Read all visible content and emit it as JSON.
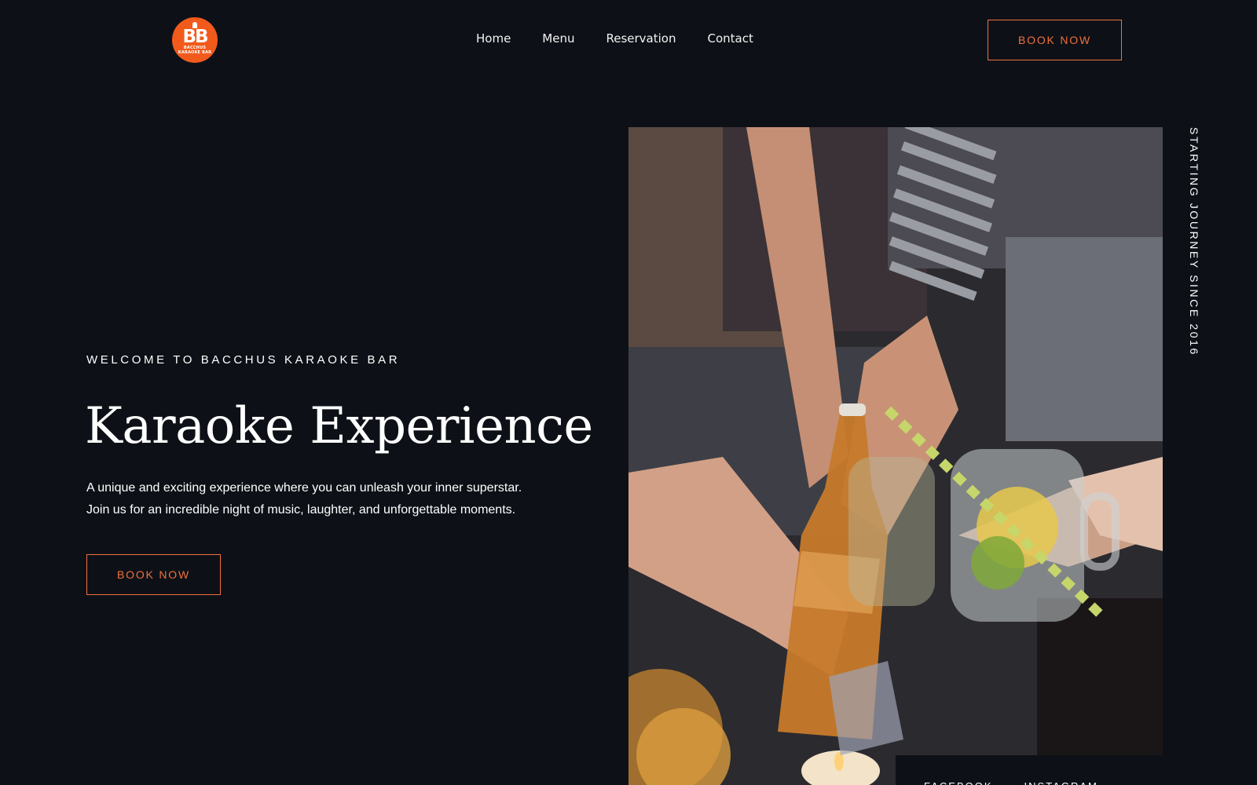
{
  "brand": {
    "logo_text": "BB",
    "logo_line1": "BACCHUS",
    "logo_line2": "KARAOKE BAR",
    "accent_color": "#f25a1c"
  },
  "nav": {
    "items": [
      {
        "label": "Home"
      },
      {
        "label": "Menu"
      },
      {
        "label": "Reservation"
      },
      {
        "label": "Contact"
      }
    ]
  },
  "header": {
    "cta_label": "BOOK NOW"
  },
  "hero": {
    "eyebrow": "WELCOME TO BACCHUS KARAOKE BAR",
    "title": "Karaoke Experience",
    "description_line1": "A unique and exciting experience where you can unleash your inner superstar.",
    "description_line2": "Join us for an incredible night of music, laughter, and unforgettable moments.",
    "cta_label": "BOOK NOW",
    "side_text": "STARTING JOURNEY SINCE 2016"
  },
  "social": {
    "items": [
      {
        "label": "FACEBOOK"
      },
      {
        "label": "INSTAGRAM"
      }
    ]
  },
  "icons": [
    "microphone-icon"
  ]
}
